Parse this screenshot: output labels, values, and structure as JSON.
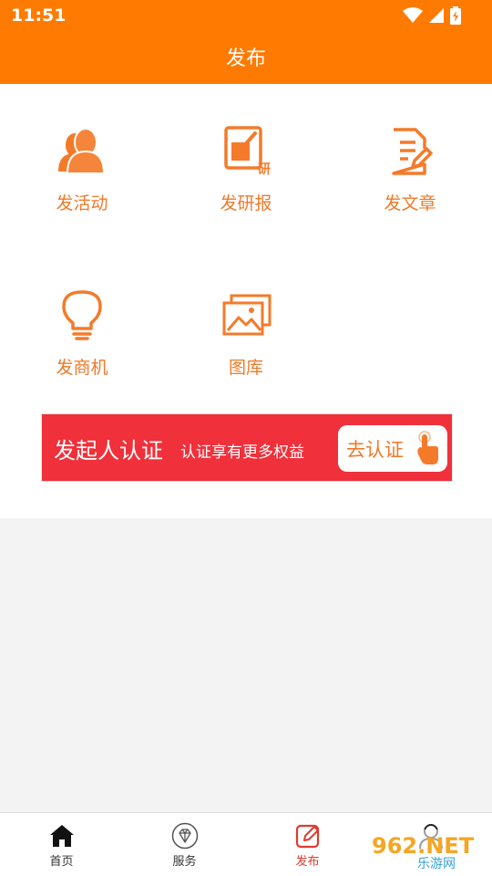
{
  "status_bar": {
    "time": "11:51"
  },
  "header": {
    "title": "发布"
  },
  "publish_grid": [
    {
      "label": "发活动",
      "icon": "people-icon"
    },
    {
      "label": "发研报",
      "icon": "report-icon"
    },
    {
      "label": "发文章",
      "icon": "article-icon"
    },
    {
      "label": "发商机",
      "icon": "lightbulb-icon"
    },
    {
      "label": "图库",
      "icon": "gallery-icon"
    }
  ],
  "report_icon_tag": "研",
  "banner": {
    "title": "发起人认证",
    "subtitle": "认证享有更多权益",
    "button_label": "去认证"
  },
  "tabbar": {
    "items": [
      {
        "label": "首页",
        "icon": "home-icon"
      },
      {
        "label": "服务",
        "icon": "diamond-icon"
      },
      {
        "label": "发布",
        "icon": "edit-icon",
        "active": true
      },
      {
        "label": "",
        "icon": "profile-icon"
      }
    ]
  },
  "watermark": {
    "brand": "962.NET",
    "site": "乐游网"
  },
  "colors": {
    "primary": "#ff7a00",
    "accent": "#ee7a2a",
    "banner": "#f0303a",
    "active_tab": "#e03a2e"
  }
}
